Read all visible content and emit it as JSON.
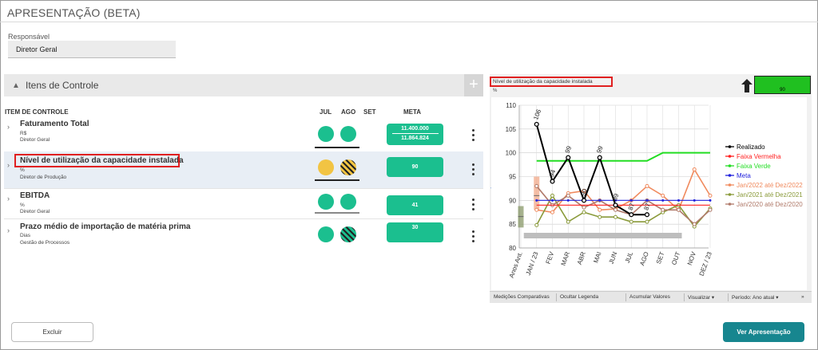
{
  "page_title": "APRESENTAÇÃO (BETA)",
  "responsavel": {
    "label": "Responsável",
    "value": "Diretor Geral"
  },
  "itens_controle": {
    "title": "Itens de Controle",
    "columns": {
      "item": "ITEM DE CONTROLE",
      "jul": "JUL",
      "ago": "AGO",
      "set": "SET",
      "meta": "META"
    },
    "rows": [
      {
        "name": "Faturamento Total",
        "unit": "R$",
        "owner": "Diretor Geral",
        "meta_line1": "11.400.000",
        "meta_line2": "11.864.824",
        "jul": "green",
        "ago": "green"
      },
      {
        "name": "Nível de utilização da capacidade instalada",
        "unit": "%",
        "owner": "Diretor de Produção",
        "meta_line1": "90",
        "jul": "yellow",
        "ago": "yellow-striped"
      },
      {
        "name": "EBITDA",
        "unit": "%",
        "owner": "Diretor Geral",
        "meta_line1": "41",
        "jul": "green",
        "ago": "green"
      },
      {
        "name": "Prazo médio de importação de matéria prima",
        "unit": "Dias",
        "owner": "Gestão de Processos",
        "meta_line1": "30",
        "jul": "green",
        "ago": "green-striped"
      }
    ]
  },
  "buttons": {
    "excluir": "Excluir",
    "ver": "Ver Apresentação"
  },
  "chart_panel": {
    "title": "Nível de utilização da capacidade instalada",
    "unit": "%",
    "indicator_value": "90",
    "toolbar": [
      "Medições Comparativas",
      "Ocultar Legenda",
      "Acumular Valores",
      "Visualizar ▾",
      "Período: Ano atual ▾",
      "»"
    ]
  },
  "colors": {
    "green": "#1bbf8f",
    "yellow": "#f2c443",
    "teal": "#17868f",
    "highlight": "#e02020"
  },
  "chart_data": {
    "type": "line",
    "x": [
      "Anos Ant.",
      "JAN / 23",
      "FEV",
      "MAR",
      "ABR",
      "MAI",
      "JUN",
      "JUL",
      "AGO",
      "SET",
      "OUT",
      "NOV",
      "DEZ / 23"
    ],
    "ylim": [
      80,
      110
    ],
    "yticks": [
      80,
      85,
      90,
      95,
      100,
      105,
      110
    ],
    "legend_position": "right",
    "series": [
      {
        "name": "Realizado",
        "color": "#000000",
        "values": [
          null,
          106,
          94,
          99,
          90,
          99,
          89,
          87,
          87,
          null,
          null,
          null,
          null
        ],
        "labels": [
          "",
          "106",
          "94",
          "99",
          "90",
          "99",
          "89",
          "87",
          "87",
          "",
          "",
          "",
          ""
        ]
      },
      {
        "name": "Faixa Vermelha",
        "color": "#ff2020",
        "values": [
          null,
          89,
          89,
          89,
          89,
          89,
          89,
          89,
          89,
          89,
          89,
          89,
          89
        ]
      },
      {
        "name": "Faixa Verde",
        "color": "#22dd22",
        "values": [
          null,
          98.3,
          98.3,
          98.3,
          98.3,
          98.3,
          98.3,
          98.3,
          98.3,
          100,
          100,
          100,
          100
        ]
      },
      {
        "name": "Meta",
        "color": "#2222dd",
        "values": [
          null,
          90,
          90,
          90,
          90,
          90,
          90,
          90,
          90,
          90,
          90,
          90,
          90
        ]
      },
      {
        "name": "Jan/2022 até Dez/2022",
        "color": "#f08a5d",
        "values": [
          null,
          88,
          87.5,
          91.5,
          92,
          88,
          88.2,
          90,
          93,
          91,
          88,
          96.5,
          91
        ]
      },
      {
        "name": "Jan/2021 até Dez/2021",
        "color": "#8a9a3a",
        "values": [
          null,
          84.8,
          91,
          85.5,
          87.5,
          86.5,
          86.5,
          85.5,
          85.5,
          87.5,
          89,
          84.5,
          88.3
        ]
      },
      {
        "name": "Jan/2020 até Dez/2020",
        "color": "#b07a6a",
        "values": [
          null,
          93,
          89,
          91,
          88.5,
          90,
          88,
          87,
          90,
          88,
          88,
          85,
          88
        ]
      }
    ],
    "boxes": [
      {
        "x": "Anos Ant.",
        "low": 84.3,
        "high": 88.8,
        "mid": 86.6,
        "color": "#8a9a6a"
      },
      {
        "x": "JAN / 23",
        "low": 88,
        "high": 95,
        "mid": 91,
        "color": "#f2a888"
      }
    ]
  }
}
